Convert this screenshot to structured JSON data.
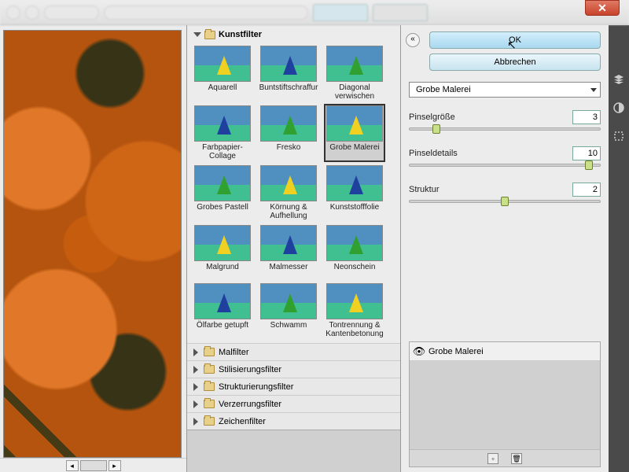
{
  "buttons": {
    "ok": "OK",
    "cancel": "Abbrechen"
  },
  "dropdown": {
    "selected": "Grobe Malerei"
  },
  "params": {
    "brush_size": {
      "label": "Pinselgröße",
      "value": "3"
    },
    "brush_detail": {
      "label": "Pinseldetails",
      "value": "10"
    },
    "texture": {
      "label": "Struktur",
      "value": "2"
    }
  },
  "categories": {
    "active": "Kunstfilter",
    "others": [
      "Malfilter",
      "Stilisierungsfilter",
      "Strukturierungsfilter",
      "Verzerrungsfilter",
      "Zeichenfilter"
    ]
  },
  "filters": [
    {
      "label": "Aquarell"
    },
    {
      "label": "Buntstiftschraffur"
    },
    {
      "label": "Diagonal verwischen"
    },
    {
      "label": "Farbpapier-Collage"
    },
    {
      "label": "Fresko"
    },
    {
      "label": "Grobe Malerei",
      "selected": true
    },
    {
      "label": "Grobes Pastell"
    },
    {
      "label": "Körnung & Aufhellung"
    },
    {
      "label": "Kunststofffolie"
    },
    {
      "label": "Malgrund"
    },
    {
      "label": "Malmesser"
    },
    {
      "label": "Neonschein"
    },
    {
      "label": "Ölfarbe getupft"
    },
    {
      "label": "Schwamm"
    },
    {
      "label": "Tontrennung & Kantenbetonung"
    }
  ],
  "layer": {
    "name": "Grobe Malerei"
  },
  "colors": {
    "accent": "#a8d8f0",
    "selection": "#333333"
  }
}
